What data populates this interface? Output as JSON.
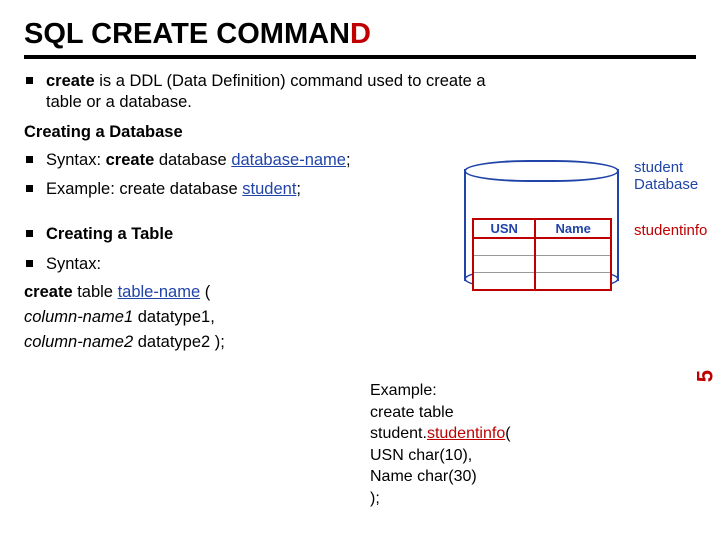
{
  "title": {
    "rest": "SQL CREATE COMMAN",
    "last": "D"
  },
  "bullet1": {
    "b": "create",
    "rest": " is a DDL (Data Definition) command used to create a table or a database."
  },
  "sub1": "Creating a Database",
  "syntax1": {
    "label": "Syntax: ",
    "b": "create",
    "mid": " database ",
    "u": "database-name",
    "end": ";"
  },
  "example1": {
    "label": "Example: create database ",
    "u": "student",
    "end": ";"
  },
  "sub2": "Creating a Table",
  "syntax2label": "Syntax:",
  "ct": {
    "l1a": "create",
    "l1b": " table ",
    "l1u": "table-name",
    "l1c": " (",
    "l2i": "column-name1",
    "l2r": " datatype1,",
    "l3i": "column-name2",
    "l3r": " datatype2 );"
  },
  "ex2": {
    "head": "Example:",
    "l1": "create table",
    "l2a": "student.",
    "l2u": "studentinfo",
    "l2b": "(",
    "l3": "USN char(10),",
    "l4": "Name char(30)",
    "l5": ");"
  },
  "diagram": {
    "toplabel": "",
    "dbname": "student",
    "dbword": "Database",
    "tablename": "studentinfo",
    "col1": "USN",
    "col2": "Name"
  },
  "pagenum": "5"
}
